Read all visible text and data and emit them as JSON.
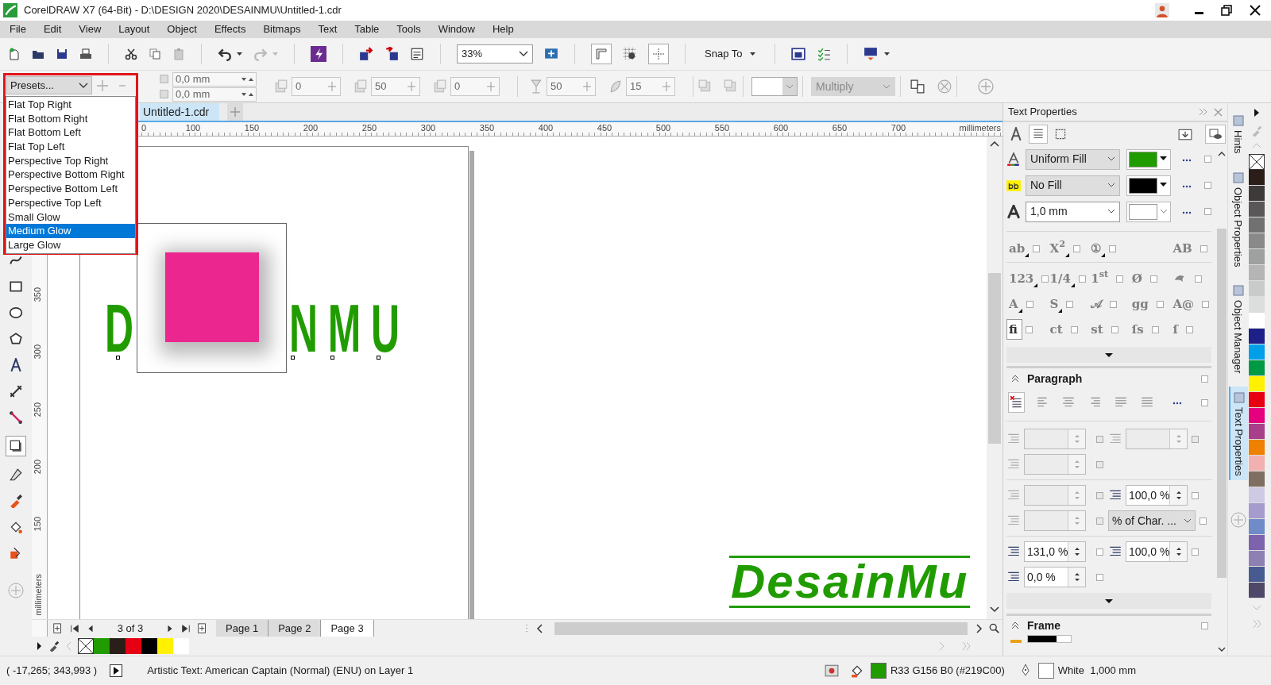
{
  "window": {
    "title": "CorelDRAW X7 (64-Bit) - D:\\DESIGN 2020\\DESAINMU\\Untitled-1.cdr"
  },
  "menu": [
    "File",
    "Edit",
    "View",
    "Layout",
    "Object",
    "Effects",
    "Bitmaps",
    "Text",
    "Table",
    "Tools",
    "Window",
    "Help"
  ],
  "toolbar": {
    "zoom": "33%",
    "snap": "Snap To"
  },
  "property_bar": {
    "presets": "Presets...",
    "offsets": [
      "0,0 mm",
      "0,0 mm"
    ],
    "fields": [
      "0",
      "50",
      "0",
      "50",
      "15"
    ],
    "merge_mode": "Multiply"
  },
  "presets_menu": [
    {
      "label": "Flat Top Right",
      "selected": false
    },
    {
      "label": "Flat Bottom Right",
      "selected": false
    },
    {
      "label": "Flat Bottom Left",
      "selected": false
    },
    {
      "label": "Flat Top Left",
      "selected": false
    },
    {
      "label": "Perspective Top Right",
      "selected": false
    },
    {
      "label": "Perspective Bottom Right",
      "selected": false
    },
    {
      "label": "Perspective Bottom Left",
      "selected": false
    },
    {
      "label": "Perspective Top Left",
      "selected": false
    },
    {
      "label": "Small Glow",
      "selected": false
    },
    {
      "label": "Medium Glow",
      "selected": true
    },
    {
      "label": "Large Glow",
      "selected": false
    }
  ],
  "document_tab": "Untitled-1.cdr",
  "horizontal_ruler": {
    "labels": [
      "0",
      "100",
      "150",
      "200",
      "250",
      "300",
      "350",
      "400",
      "450",
      "500",
      "550",
      "600",
      "650",
      "700"
    ],
    "unit": "millimeters"
  },
  "vertical_ruler": {
    "labels": [
      "350",
      "300",
      "250",
      "200",
      "150"
    ],
    "unit": "millimeters"
  },
  "toolbox": [
    {
      "kind": "curve",
      "selected": false
    },
    {
      "kind": "rectangle",
      "selected": false
    },
    {
      "kind": "ellipse",
      "selected": false
    },
    {
      "kind": "polygon",
      "selected": false
    },
    {
      "kind": "text",
      "selected": false
    },
    {
      "kind": "dimension",
      "selected": false
    },
    {
      "kind": "connector",
      "selected": false
    },
    {
      "kind": "shadow",
      "selected": true
    },
    {
      "kind": "transparency",
      "selected": false
    },
    {
      "kind": "eyedropper",
      "selected": false
    },
    {
      "kind": "fill",
      "selected": false
    },
    {
      "kind": "smart_fill",
      "selected": false
    }
  ],
  "canvas": {
    "text_fragments": [
      "D",
      "NMU"
    ],
    "logo": "DesainMu"
  },
  "page_nav": {
    "counter": "3 of 3",
    "pages": [
      {
        "label": "Page 1",
        "selected": false
      },
      {
        "label": "Page 2",
        "selected": false
      },
      {
        "label": "Page 3",
        "selected": true
      }
    ]
  },
  "document_palette": [
    {
      "kind": "none"
    },
    {
      "kind": "swatch",
      "color": "#219c00"
    },
    {
      "kind": "swatch",
      "color": "#2b1d18"
    },
    {
      "kind": "swatch",
      "color": "#e60012"
    },
    {
      "kind": "swatch",
      "color": "#000000"
    },
    {
      "kind": "swatch",
      "color": "#fff100"
    },
    {
      "kind": "swatch",
      "color": "#ffffff"
    }
  ],
  "docker": {
    "title": "Text Properties",
    "views": [
      {
        "kind": "character",
        "selected": false
      },
      {
        "kind": "paragraph",
        "selected": true
      },
      {
        "kind": "frame",
        "selected": false
      }
    ],
    "fills": [
      {
        "kind": "fill",
        "type": "Uniform Fill",
        "color": "#219c00",
        "checked": false
      },
      {
        "kind": "background",
        "type": "No Fill",
        "color": "#000000",
        "checked": false
      },
      {
        "kind": "outline",
        "type": "1,0 mm",
        "color": "#ffffff",
        "checked": false
      }
    ],
    "features": [
      [
        {
          "kind": "glyph",
          "glyph": "ab",
          "menu": true,
          "selected": false,
          "checked": false
        },
        {
          "kind": "glyph",
          "glyph": "X$^{2}$",
          "menu": true,
          "selected": false,
          "checked": false
        },
        {
          "kind": "glyph",
          "glyph": "①",
          "menu": true,
          "selected": false,
          "checked": false
        },
        {
          "kind": "glyph",
          "glyph": "AB",
          "menu": false,
          "selected": false,
          "checked": false
        }
      ],
      [
        {
          "kind": "glyph",
          "glyph": "123",
          "menu": true,
          "selected": false,
          "checked": false
        },
        {
          "kind": "glyph",
          "glyph": "1/4",
          "menu": true,
          "selected": false,
          "checked": false
        },
        {
          "kind": "glyph",
          "glyph": "1$^{st}$",
          "menu": false,
          "selected": false,
          "checked": false
        },
        {
          "kind": "glyph",
          "glyph": "Ø",
          "menu": false,
          "selected": false,
          "checked": false
        },
        {
          "kind": "icon",
          "menu": false,
          "selected": false,
          "checked": false
        }
      ],
      [
        {
          "kind": "glyph",
          "glyph": "A",
          "menu": true,
          "selected": false,
          "checked": false
        },
        {
          "kind": "glyph",
          "glyph": "S",
          "menu": true,
          "selected": false,
          "checked": false
        },
        {
          "kind": "glyph",
          "glyph": "𝒜",
          "menu": false,
          "selected": false,
          "checked": false
        },
        {
          "kind": "glyph",
          "glyph": "gg",
          "menu": false,
          "selected": false,
          "checked": false
        },
        {
          "kind": "glyph",
          "glyph": "A@",
          "menu": false,
          "selected": false,
          "checked": false
        }
      ],
      [
        {
          "kind": "glyph",
          "glyph": "fi",
          "menu": false,
          "selected": true,
          "checked": false
        },
        {
          "kind": "glyph",
          "glyph": "ct",
          "menu": false,
          "selected": false,
          "checked": false
        },
        {
          "kind": "glyph",
          "glyph": "st",
          "menu": false,
          "selected": false,
          "checked": false
        },
        {
          "kind": "glyph",
          "glyph": "ſs",
          "menu": false,
          "selected": false,
          "checked": false
        },
        {
          "kind": "glyph",
          "glyph": "ſ",
          "menu": false,
          "selected": false,
          "checked": false
        }
      ]
    ],
    "paragraph": {
      "title": "Paragraph",
      "checked": false,
      "alignment_checked": false,
      "alignments": [
        {
          "kind": "none",
          "selected": true
        },
        {
          "kind": "left",
          "selected": false
        },
        {
          "kind": "center",
          "selected": false
        },
        {
          "kind": "right",
          "selected": false
        },
        {
          "kind": "full",
          "selected": false
        },
        {
          "kind": "force",
          "selected": false
        }
      ],
      "rows": [
        [
          {
            "kind": "spin",
            "disabled": true,
            "checked": false
          },
          {
            "kind": "spin",
            "disabled": true,
            "checked": false
          }
        ],
        [
          {
            "kind": "spin",
            "disabled": true,
            "checked": false
          }
        ],
        [
          {
            "kind": "spin",
            "disabled": true,
            "checked": false
          },
          {
            "kind": "spin",
            "disabled": false,
            "value": "100,0 %",
            "checked": false
          }
        ],
        [
          {
            "kind": "spin",
            "disabled": true,
            "checked": false
          },
          {
            "kind": "dropdown",
            "disabled": false,
            "value": "% of Char. ...",
            "checked": false
          }
        ],
        [
          {
            "kind": "spin",
            "disabled": false,
            "value": "131,0 %",
            "checked": false
          },
          {
            "kind": "spin",
            "disabled": false,
            "value": "100,0 %",
            "checked": false
          }
        ],
        [
          {
            "kind": "spin",
            "disabled": false,
            "value": "0,0 %",
            "checked": false
          }
        ]
      ]
    },
    "frame": {
      "title": "Frame",
      "checked": false
    }
  },
  "docker_tabs": [
    {
      "label": "Hints",
      "selected": false
    },
    {
      "label": "Object Properties",
      "selected": false
    },
    {
      "label": "Object Manager",
      "selected": false
    },
    {
      "label": "Text Properties",
      "selected": true
    }
  ],
  "color_palette": [
    {
      "kind": "none"
    },
    {
      "kind": "swatch",
      "color": "#2b1d18"
    },
    {
      "kind": "swatch",
      "color": "#3e3a39"
    },
    {
      "kind": "swatch",
      "color": "#595757"
    },
    {
      "kind": "swatch",
      "color": "#727171"
    },
    {
      "kind": "swatch",
      "color": "#898989"
    },
    {
      "kind": "swatch",
      "color": "#9fa0a0"
    },
    {
      "kind": "swatch",
      "color": "#b5b5b6"
    },
    {
      "kind": "swatch",
      "color": "#c9caca"
    },
    {
      "kind": "swatch",
      "color": "#dcdddd"
    },
    {
      "kind": "swatch",
      "color": "#ffffff"
    },
    {
      "kind": "swatch",
      "color": "#1d2088"
    },
    {
      "kind": "swatch",
      "color": "#00a0e9"
    },
    {
      "kind": "swatch",
      "color": "#009944"
    },
    {
      "kind": "swatch",
      "color": "#fff100"
    },
    {
      "kind": "swatch",
      "color": "#e60012"
    },
    {
      "kind": "swatch",
      "color": "#e4007f"
    },
    {
      "kind": "swatch",
      "color": "#a83f8b"
    },
    {
      "kind": "swatch",
      "color": "#ee8100"
    },
    {
      "kind": "swatch",
      "color": "#f2b1b1"
    },
    {
      "kind": "swatch",
      "color": "#7f6f63"
    },
    {
      "kind": "swatch",
      "color": "#cfcae3"
    },
    {
      "kind": "swatch",
      "color": "#a59bcc"
    },
    {
      "kind": "swatch",
      "color": "#6f8bc8"
    },
    {
      "kind": "swatch",
      "color": "#7d63ae"
    },
    {
      "kind": "swatch",
      "color": "#8f80b4"
    },
    {
      "kind": "swatch",
      "color": "#485b91"
    },
    {
      "kind": "swatch",
      "color": "#4f4868"
    }
  ],
  "status_bar": {
    "coordinates": "( -17,265; 343,993 )",
    "info": "Artistic Text: American Captain (Normal) (ENU) on Layer 1",
    "fill": {
      "color": "#219c00",
      "label": "R33 G156 B0 (#219C00)"
    },
    "outline": {
      "color": "#ffffff",
      "label": "White  1,000 mm"
    }
  }
}
